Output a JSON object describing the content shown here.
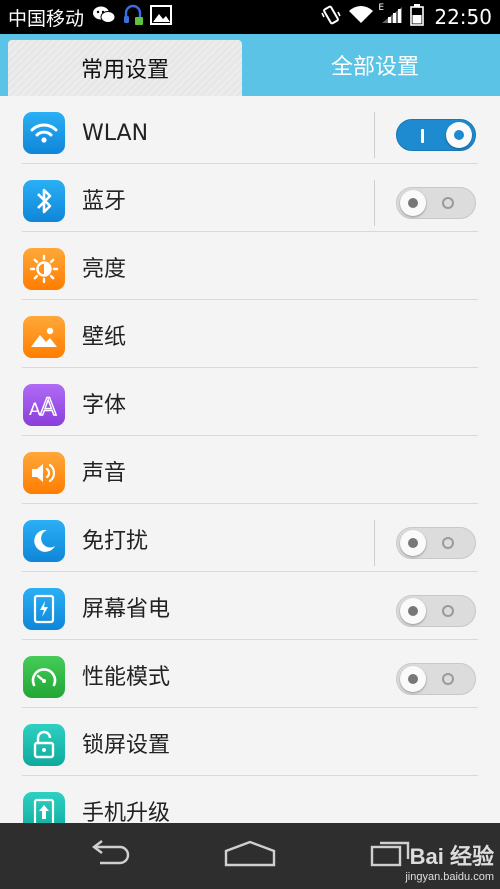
{
  "status_bar": {
    "carrier": "中国移动",
    "time": "22:50",
    "signal_label": "E"
  },
  "tabs": {
    "common": "常用设置",
    "all": "全部设置"
  },
  "settings": [
    {
      "label": "WLAN",
      "icon": "wifi-icon",
      "color": "#1a9be6",
      "toggle": "on"
    },
    {
      "label": "蓝牙",
      "icon": "bluetooth-icon",
      "color": "#1a9be6",
      "toggle": "off"
    },
    {
      "label": "亮度",
      "icon": "brightness-icon",
      "color": "#ff8a12",
      "toggle": "none"
    },
    {
      "label": "壁纸",
      "icon": "wallpaper-icon",
      "color": "#ff8a12",
      "toggle": "none"
    },
    {
      "label": "字体",
      "icon": "font-icon",
      "color": "#9b4fe6",
      "toggle": "none"
    },
    {
      "label": "声音",
      "icon": "sound-icon",
      "color": "#ff8a12",
      "toggle": "none"
    },
    {
      "label": "免打扰",
      "icon": "moon-icon",
      "color": "#1a9be6",
      "toggle": "off"
    },
    {
      "label": "屏幕省电",
      "icon": "screen-power-icon",
      "color": "#1a9be6",
      "toggle": "off"
    },
    {
      "label": "性能模式",
      "icon": "gauge-icon",
      "color": "#2fb844",
      "toggle": "off"
    },
    {
      "label": "锁屏设置",
      "icon": "lock-icon",
      "color": "#17bdb0",
      "toggle": "none"
    },
    {
      "label": "手机升级",
      "icon": "upgrade-icon",
      "color": "#17bdb0",
      "toggle": "none"
    }
  ],
  "watermark": {
    "logo": "Bai 经验",
    "site": "jingyan.baidu.com"
  }
}
